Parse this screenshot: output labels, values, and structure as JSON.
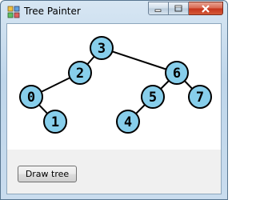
{
  "window": {
    "title": "Tree Painter",
    "controls": [
      "minimize",
      "maximize",
      "close"
    ]
  },
  "tree": {
    "node_fill": "#87ceeb",
    "node_stroke": "#000000",
    "nodes": [
      {
        "label": "3"
      },
      {
        "label": "2"
      },
      {
        "label": "6"
      },
      {
        "label": "0"
      },
      {
        "label": "5"
      },
      {
        "label": "7"
      },
      {
        "label": "1"
      },
      {
        "label": "4"
      }
    ],
    "edges": [
      [
        "3",
        "2"
      ],
      [
        "3",
        "6"
      ],
      [
        "2",
        "0"
      ],
      [
        "0",
        "1"
      ],
      [
        "6",
        "5"
      ],
      [
        "6",
        "7"
      ],
      [
        "5",
        "4"
      ]
    ]
  },
  "actions": {
    "draw_label": "Draw tree"
  }
}
